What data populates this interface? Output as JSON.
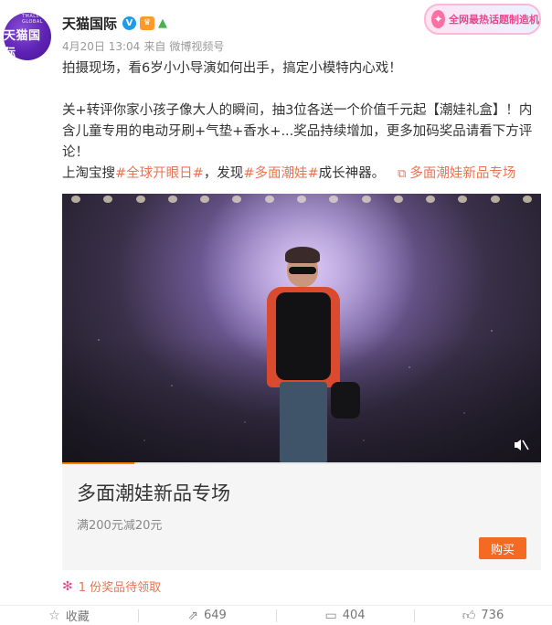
{
  "author": {
    "name": "天猫国际",
    "avatar_text": "天猫国际",
    "avatar_small_text": "TMALL GLOBAL",
    "verified_icon": "verified-icon",
    "vip_icon": "vip-crown-icon",
    "level_icon": "level-badge-icon"
  },
  "meta": {
    "time": "4月20日 13:04",
    "source_prefix": "来自",
    "source": "微博视频号"
  },
  "promo_badge": {
    "label": "全网最热话题制造机",
    "icon": "megaphone-icon"
  },
  "post": {
    "line1": "拍摄现场，看6岁小小导演如何出手，搞定小模特内心戏！",
    "line2": "关+转评你家小孩子像大人的瞬间，抽3位各送一个价值千元起【潮娃礼盒】！内含儿童专用的电动牙刷+气垫+香水+...奖品持续增加，更多加码奖品请看下方评论！",
    "line3_prefix": "上淘宝搜",
    "hashtag1": "#全球开眼日#",
    "line3_mid": "，发现",
    "hashtag2": "#多面潮娃#",
    "line3_suffix": "成长神器。",
    "topic_link": "多面潮娃新品专场"
  },
  "video": {
    "progress": 0.15
  },
  "product": {
    "title": "多面潮娃新品专场",
    "promo": "满200元减20元",
    "buy_label": "购买"
  },
  "prize": {
    "text": "1 份奖品待领取"
  },
  "actions": {
    "favorite_label": "收藏",
    "repost_count": "649",
    "comment_count": "404",
    "like_count": "736"
  },
  "colors": {
    "link": "#eb7350",
    "accent": "#ff8200",
    "buy_button": "#f46a23",
    "avatar": "#5d22b4"
  }
}
